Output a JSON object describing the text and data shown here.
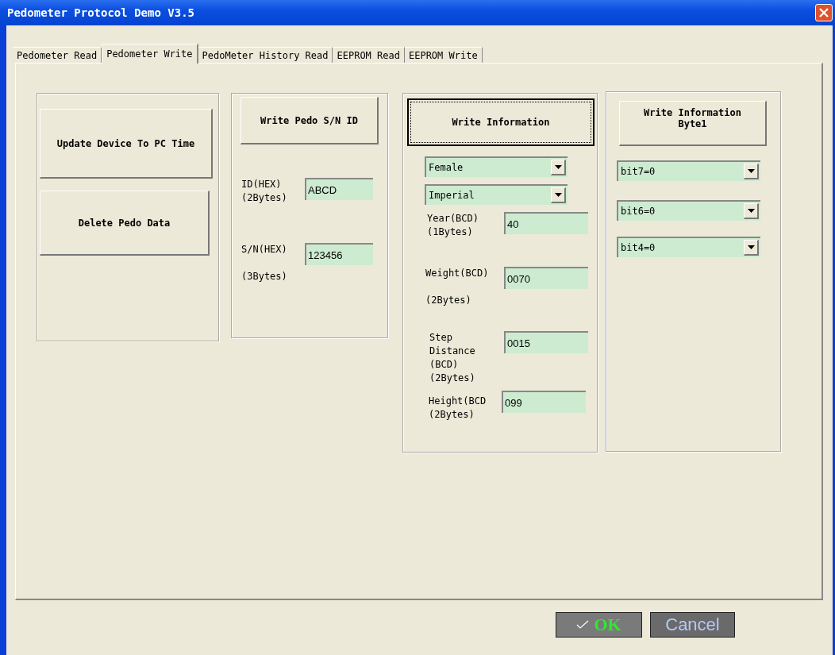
{
  "window": {
    "title": "Pedometer Protocol Demo V3.5"
  },
  "tabs": [
    {
      "label": "Pedometer Read",
      "selected": false
    },
    {
      "label": "Pedometer Write",
      "selected": true
    },
    {
      "label": "PedoMeter History Read",
      "selected": false
    },
    {
      "label": "EEPROM Read",
      "selected": false
    },
    {
      "label": "EEPROM Write",
      "selected": false
    }
  ],
  "device_panel": {
    "buttons": [
      "Update Device To PC Time",
      "Delete Pedo Data"
    ]
  },
  "sn_panel": {
    "button": "Write Pedo S/N ID",
    "fields": [
      {
        "label": "ID(HEX)\n(2Bytes)",
        "value": "ABCD"
      },
      {
        "label": "S/N(HEX)\n\n(3Bytes)",
        "value": "123456"
      }
    ]
  },
  "info_panel": {
    "button": "Write Information",
    "focused": true,
    "dropdowns": [
      "Female",
      "Imperial"
    ],
    "fields": [
      {
        "label": "Year(BCD)\n(1Bytes)",
        "value": "40"
      },
      {
        "label": "Weight(BCD)\n\n(2Bytes)",
        "value": "0070"
      },
      {
        "label": "Step\nDistance\n(BCD)\n(2Bytes)",
        "value": "0015"
      },
      {
        "label": "Height(BCD\n(2Bytes)",
        "value": "099"
      }
    ]
  },
  "byte1_panel": {
    "button": "Write Information\nByte1",
    "dropdowns": [
      "bit7=0",
      "bit6=0",
      "bit4=0"
    ]
  },
  "footer": {
    "ok": "OK",
    "cancel": "Cancel"
  }
}
